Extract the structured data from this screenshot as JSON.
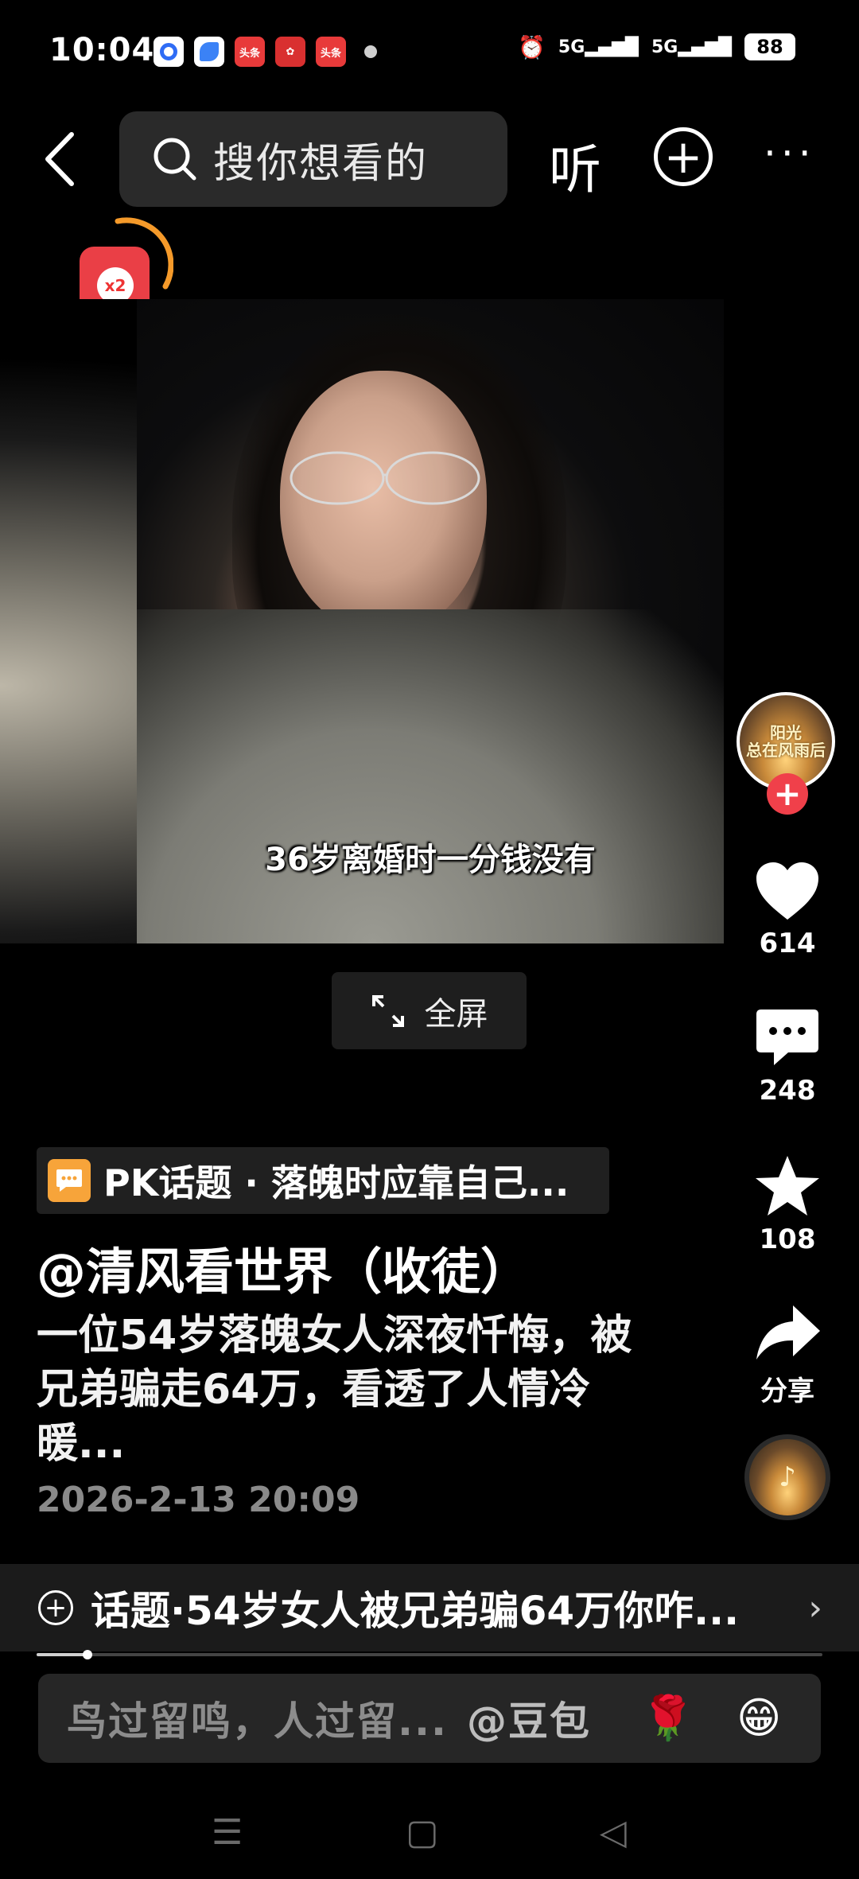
{
  "status_bar": {
    "time": "10:04",
    "notifications": [
      {
        "icon": "circle-app-icon",
        "color": "#2f6cf5",
        "label": ""
      },
      {
        "icon": "feather-app-icon",
        "color": "#3b82f6",
        "label": ""
      },
      {
        "icon": "toutiao-app-icon",
        "color": "#e83a3a",
        "label": "头条"
      },
      {
        "icon": "game-app-icon",
        "color": "#d93030",
        "label": ""
      },
      {
        "icon": "toutiao-app-icon",
        "color": "#e83a3a",
        "label": "头条"
      }
    ],
    "battery": "88"
  },
  "top_nav": {
    "search_placeholder": "搜你想看的",
    "listen_label": "听"
  },
  "red_packet": {
    "badge": "x2"
  },
  "video": {
    "subtitle": "36岁离婚时一分钱没有",
    "fullscreen_label": "全屏"
  },
  "rail": {
    "avatar_text_line1": "阳光",
    "avatar_text_line2": "总在风雨后",
    "likes": "614",
    "comments": "248",
    "favorites": "108",
    "share_label": "分享"
  },
  "info": {
    "pk_tag": "PK话题 · 落魄时应靠自己...",
    "author": "@清风看世界（收徒）",
    "description": "一位54岁落魄女人深夜忏悔，被兄弟骗走64万，看透了人情冷暖...",
    "date": "2026-2-13 20:09"
  },
  "topic_bar": {
    "text": "话题·54岁女人被兄弟骗64万你咋..."
  },
  "progress": 0.065,
  "comment_box": {
    "placeholder": "鸟过留鸣，人过留...",
    "mention": "@豆包",
    "emoji1": "🌹",
    "emoji2": "😁"
  },
  "colors": {
    "accent_red": "#f0404a",
    "pk_orange": "#f7a43a",
    "background": "#000000"
  }
}
